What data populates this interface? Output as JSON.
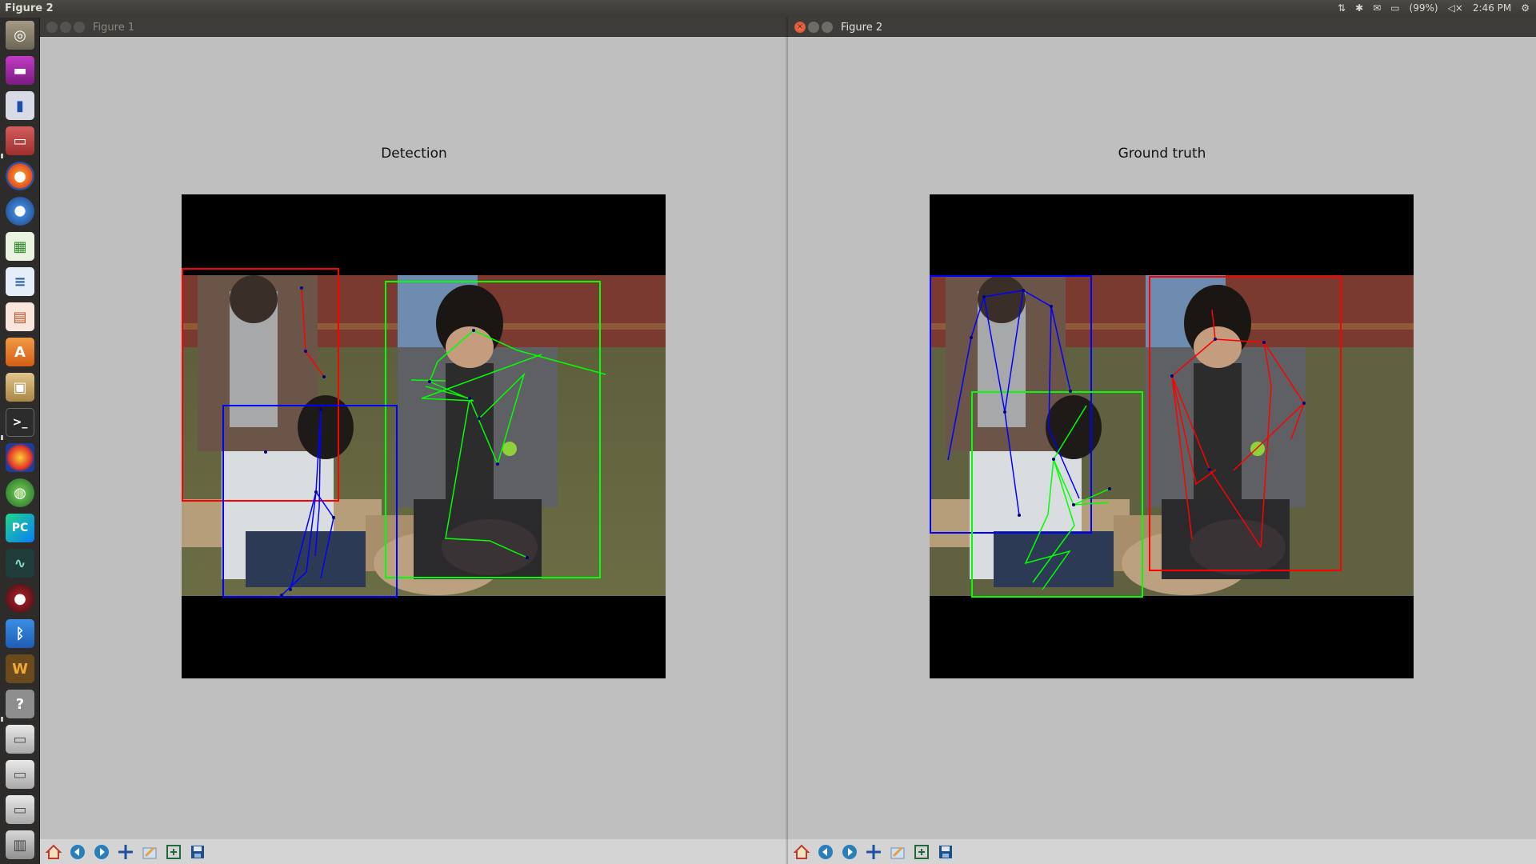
{
  "topbar": {
    "title": "Figure 2",
    "battery": "(99%)",
    "time": "2:46 PM"
  },
  "launcher": {
    "icons": [
      "ubuntu-dash-icon",
      "video-player-icon",
      "thermometer-icon",
      "file-manager-icon",
      "firefox-icon",
      "chromium-icon",
      "spreadsheet-icon",
      "writer-icon",
      "impress-icon",
      "software-center-icon",
      "archive-manager-icon",
      "terminal-icon",
      "display-settings-icon",
      "matlab-icon",
      "pycharm-icon",
      "system-monitor-icon",
      "screen-recorder-icon",
      "bluetooth-icon",
      "oscilloscope-icon",
      "help-icon",
      "drive-icon",
      "drive-icon",
      "drive-icon",
      "trash-icon"
    ]
  },
  "window1": {
    "title": "Figure 1",
    "plot_title": "Detection"
  },
  "window2": {
    "title": "Figure 2",
    "plot_title": "Ground truth"
  },
  "toolbar_tools": [
    "home-icon",
    "back-icon",
    "forward-icon",
    "pan-icon",
    "zoom-icon",
    "configure-subplots-icon",
    "save-icon"
  ],
  "colors": {
    "red": "#ff0000",
    "green": "#00ff00",
    "blue": "#0000ff"
  }
}
